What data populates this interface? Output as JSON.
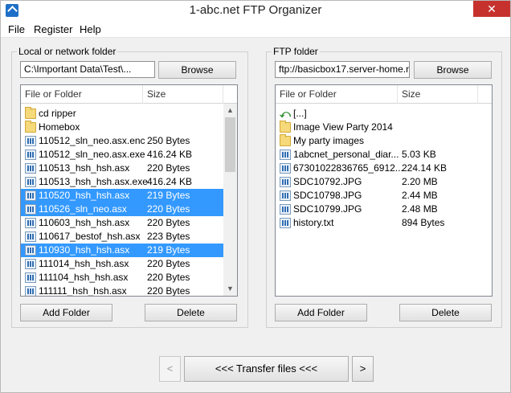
{
  "window": {
    "title": "1-abc.net FTP Organizer",
    "close_glyph": "✕"
  },
  "menu": [
    "File",
    "Register",
    "Help"
  ],
  "local": {
    "group_label": "Local or network folder",
    "path": "C:\\Important Data\\Test\\...",
    "browse_label": "Browse",
    "columns": [
      "File or Folder",
      "Size"
    ],
    "items": [
      {
        "icon": "folder-icon",
        "name": "cd ripper",
        "size": "",
        "selected": false
      },
      {
        "icon": "folder-icon",
        "name": "Homebox",
        "size": "",
        "selected": false
      },
      {
        "icon": "file-icon",
        "name": "110512_sln_neo.asx.enc",
        "size": "250 Bytes",
        "selected": false
      },
      {
        "icon": "file-icon",
        "name": "110512_sln_neo.asx.exe",
        "size": "416.24 KB",
        "selected": false
      },
      {
        "icon": "file-icon",
        "name": "110513_hsh_hsh.asx",
        "size": "220 Bytes",
        "selected": false
      },
      {
        "icon": "file-icon",
        "name": "110513_hsh_hsh.asx.exe",
        "size": "416.24 KB",
        "selected": false
      },
      {
        "icon": "file-icon",
        "name": "110520_hsh_hsh.asx",
        "size": "219 Bytes",
        "selected": true
      },
      {
        "icon": "file-icon",
        "name": "110526_sln_neo.asx",
        "size": "220 Bytes",
        "selected": true
      },
      {
        "icon": "file-icon",
        "name": "110603_hsh_hsh.asx",
        "size": "220 Bytes",
        "selected": false
      },
      {
        "icon": "file-icon",
        "name": "110617_bestof_hsh.asx",
        "size": "223 Bytes",
        "selected": false
      },
      {
        "icon": "file-icon",
        "name": "110930_hsh_hsh.asx",
        "size": "219 Bytes",
        "selected": true
      },
      {
        "icon": "file-icon",
        "name": "111014_hsh_hsh.asx",
        "size": "220 Bytes",
        "selected": false
      },
      {
        "icon": "file-icon",
        "name": "111104_hsh_hsh.asx",
        "size": "220 Bytes",
        "selected": false
      },
      {
        "icon": "file-icon",
        "name": "111111_hsh_hsh.asx",
        "size": "220 Bytes",
        "selected": false
      }
    ],
    "add_folder_label": "Add Folder",
    "delete_label": "Delete"
  },
  "ftp": {
    "group_label": "FTP folder",
    "path": "ftp://basicbox17.server-home.ne",
    "browse_label": "Browse",
    "columns": [
      "File or Folder",
      "Size"
    ],
    "items": [
      {
        "icon": "up-icon",
        "name": "[...]",
        "size": ""
      },
      {
        "icon": "folder-icon",
        "name": "Image View Party 2014",
        "size": ""
      },
      {
        "icon": "folder-icon",
        "name": "My party images",
        "size": ""
      },
      {
        "icon": "file-icon",
        "name": "1abcnet_personal_diar...",
        "size": "5.03 KB"
      },
      {
        "icon": "file-icon",
        "name": "67301022836765_6912...",
        "size": "224.14 KB"
      },
      {
        "icon": "file-icon",
        "name": "SDC10792.JPG",
        "size": "2.20 MB"
      },
      {
        "icon": "file-icon",
        "name": "SDC10798.JPG",
        "size": "2.44 MB"
      },
      {
        "icon": "file-icon",
        "name": "SDC10799.JPG",
        "size": "2.48 MB"
      },
      {
        "icon": "file-icon",
        "name": "history.txt",
        "size": "894 Bytes"
      }
    ],
    "add_folder_label": "Add Folder",
    "delete_label": "Delete"
  },
  "transfer": {
    "prev_label": "<",
    "label": "<<<  Transfer files  <<<",
    "next_label": ">"
  },
  "colors": {
    "selection": "#3399ff",
    "close": "#c7312d"
  }
}
